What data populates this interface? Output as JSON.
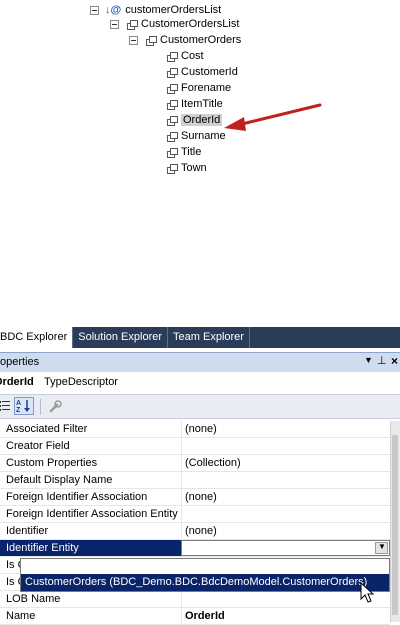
{
  "tree": {
    "root": "customerOrdersList",
    "list": "CustomerOrdersList",
    "entity": "CustomerOrders",
    "fields": [
      "Cost",
      "CustomerId",
      "Forename",
      "ItemTitle",
      "OrderId",
      "Surname",
      "Title",
      "Town"
    ],
    "highlighted": "OrderId"
  },
  "tabs": [
    {
      "label": "BDC Explorer"
    },
    {
      "label": "Solution Explorer"
    },
    {
      "label": "Team Explorer"
    }
  ],
  "properties_panel": {
    "title": "Properties",
    "object_name": "OrderId",
    "object_type": "TypeDescriptor"
  },
  "grid": {
    "rows": [
      {
        "name": "Associated Filter",
        "value": "(none)"
      },
      {
        "name": "Creator Field",
        "value": ""
      },
      {
        "name": "Custom Properties",
        "value": "(Collection)"
      },
      {
        "name": "Default Display Name",
        "value": ""
      },
      {
        "name": "Foreign Identifier Association",
        "value": "(none)"
      },
      {
        "name": "Foreign Identifier Association Entity",
        "value": ""
      },
      {
        "name": "Identifier",
        "value": "(none)"
      },
      {
        "name": "Identifier Entity",
        "value": ""
      },
      {
        "name": "Is C",
        "value": ""
      },
      {
        "name": "Is C",
        "value": ""
      },
      {
        "name": "LOB Name",
        "value": ""
      },
      {
        "name": "Name",
        "value": "OrderId"
      }
    ],
    "selected_row": "Identifier Entity"
  },
  "dropdown": {
    "option": "CustomerOrders (BDC_Demo.BDC.BdcDemoModel.CustomerOrders)"
  },
  "colors": {
    "tab_bar": "#2b3c59",
    "selection": "#0a246a",
    "arrow": "#c0201f"
  }
}
